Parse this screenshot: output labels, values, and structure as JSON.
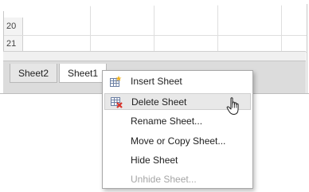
{
  "grid": {
    "row_labels": [
      "20",
      "21"
    ]
  },
  "tabs": [
    {
      "label": "Sheet2"
    },
    {
      "label": "Sheet1"
    }
  ],
  "context_menu": {
    "items": [
      {
        "label": "Insert Sheet",
        "icon": "insert-sheet-icon"
      },
      {
        "label": "Delete Sheet",
        "icon": "delete-sheet-icon"
      },
      {
        "label": "Rename Sheet..."
      },
      {
        "label": "Move or Copy Sheet..."
      },
      {
        "label": "Hide Sheet"
      },
      {
        "label": "Unhide Sheet..."
      }
    ]
  },
  "colors": {
    "tabbar_bg": "#dcdcdc",
    "menu_hover_bg": "#e8e8e8",
    "disabled_text": "#a5a5a5",
    "delete_icon": "#d9342b"
  }
}
